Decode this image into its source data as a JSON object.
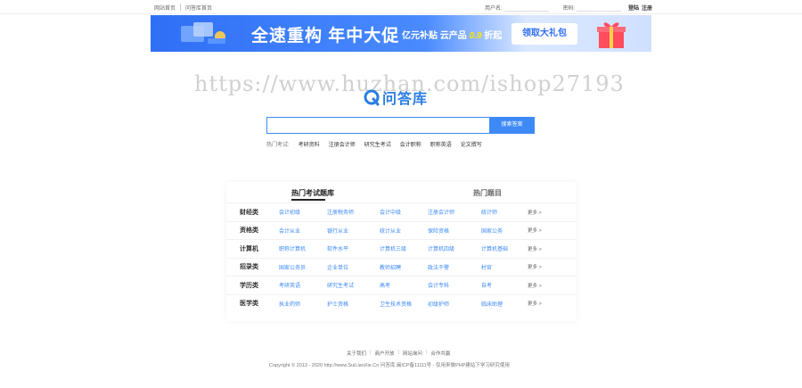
{
  "topbar": {
    "links": [
      "网站首页",
      "问答库首页"
    ],
    "username_label": "用户名:",
    "password_label": "密码:",
    "login": "登陆",
    "register": "注册"
  },
  "banner": {
    "slogan": "全速重构 年中大促",
    "sub_prefix": "亿元补贴 云产品",
    "sub_highlight": "0.9",
    "sub_suffix": "折起",
    "cta": "领取大礼包"
  },
  "watermark": "https://www.huzhan.com/ishop27193",
  "logo": {
    "text": "问答库"
  },
  "search": {
    "value": "",
    "button": "搜索答案"
  },
  "hot_exams": {
    "label": "热门考试:",
    "items": [
      "考研资料",
      "注册会计师",
      "研究生考试",
      "会计职称",
      "职称英语",
      "论文撰写"
    ]
  },
  "panel": {
    "tabs": [
      {
        "label": "热门考试题库",
        "active": true
      },
      {
        "label": "热门题目",
        "active": false
      }
    ],
    "rows": [
      {
        "category": "财经类",
        "items": [
          "会计初级",
          "注册税务师",
          "会计中级",
          "注册会计师",
          "统计师"
        ],
        "more": "更多 >"
      },
      {
        "category": "资格类",
        "items": [
          "会计从业",
          "银行从业",
          "统计从业",
          "保险资格",
          "国家公务"
        ],
        "more": "更多 >"
      },
      {
        "category": "计算机",
        "items": [
          "职称计算机",
          "软件水平",
          "计算机三级",
          "计算机四级",
          "计算机基础"
        ],
        "more": "更多 >"
      },
      {
        "category": "招录类",
        "items": [
          "国家公务员",
          "企业单位",
          "教师招聘",
          "政法干警",
          "村官"
        ],
        "more": "更多 >"
      },
      {
        "category": "学历类",
        "items": [
          "考研英语",
          "研究生考试",
          "高考",
          "会计专科",
          "自考"
        ],
        "more": "更多 >"
      },
      {
        "category": "医学类",
        "items": [
          "执业药师",
          "护士资格",
          "卫生技术资格",
          "初级护师",
          "临床助理"
        ],
        "more": "更多 >"
      }
    ]
  },
  "footer": {
    "links": [
      "关于我们",
      "商户开放",
      "网站询问",
      "合作共赢"
    ],
    "copyright": "Copyright © 2013 - 2020 http://www.SuiLianXie.Cn 问答库 闽ICP备11111号 - 仅用来做PHP建站下学习研究使用"
  }
}
